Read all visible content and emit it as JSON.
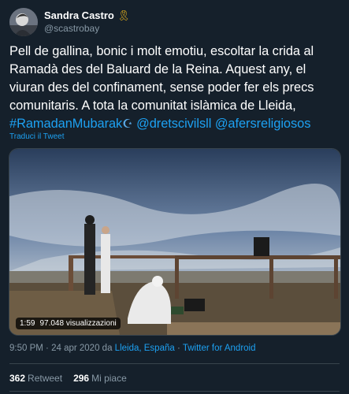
{
  "author": {
    "display_name": "Sandra Castro",
    "ribbon_icon": "yellow-ribbon-icon",
    "handle": "@scastrobay"
  },
  "tweet": {
    "text_part1": "Pell de gallina, bonic i molt emotiu, escoltar la crida al Ramadà des del Baluard de la Reina. Aquest any, el viuran des del confinament, sense poder fer els precs comunitaris. A tota la comunitat islàmica de Lleida,",
    "hashtag": "#RamadanMubarak",
    "mention1": "@dretscivilsll",
    "mention2": "@afersreligiosos"
  },
  "translate_label": "Traduci il Tweet",
  "video": {
    "duration": "1:59",
    "views": "97.048 visualizzazioni"
  },
  "meta": {
    "time": "9:50 PM",
    "separator": "·",
    "date": "24 apr 2020",
    "from_word": "da",
    "location": "Lleida, España",
    "client": "Twitter for Android"
  },
  "stats": {
    "retweets_count": "362",
    "retweets_label": "Retweet",
    "likes_count": "296",
    "likes_label": "Mi piace"
  },
  "colors": {
    "background": "#15202b",
    "link": "#1da1f2",
    "secondary_text": "#8899a6",
    "divider": "#38444d"
  }
}
